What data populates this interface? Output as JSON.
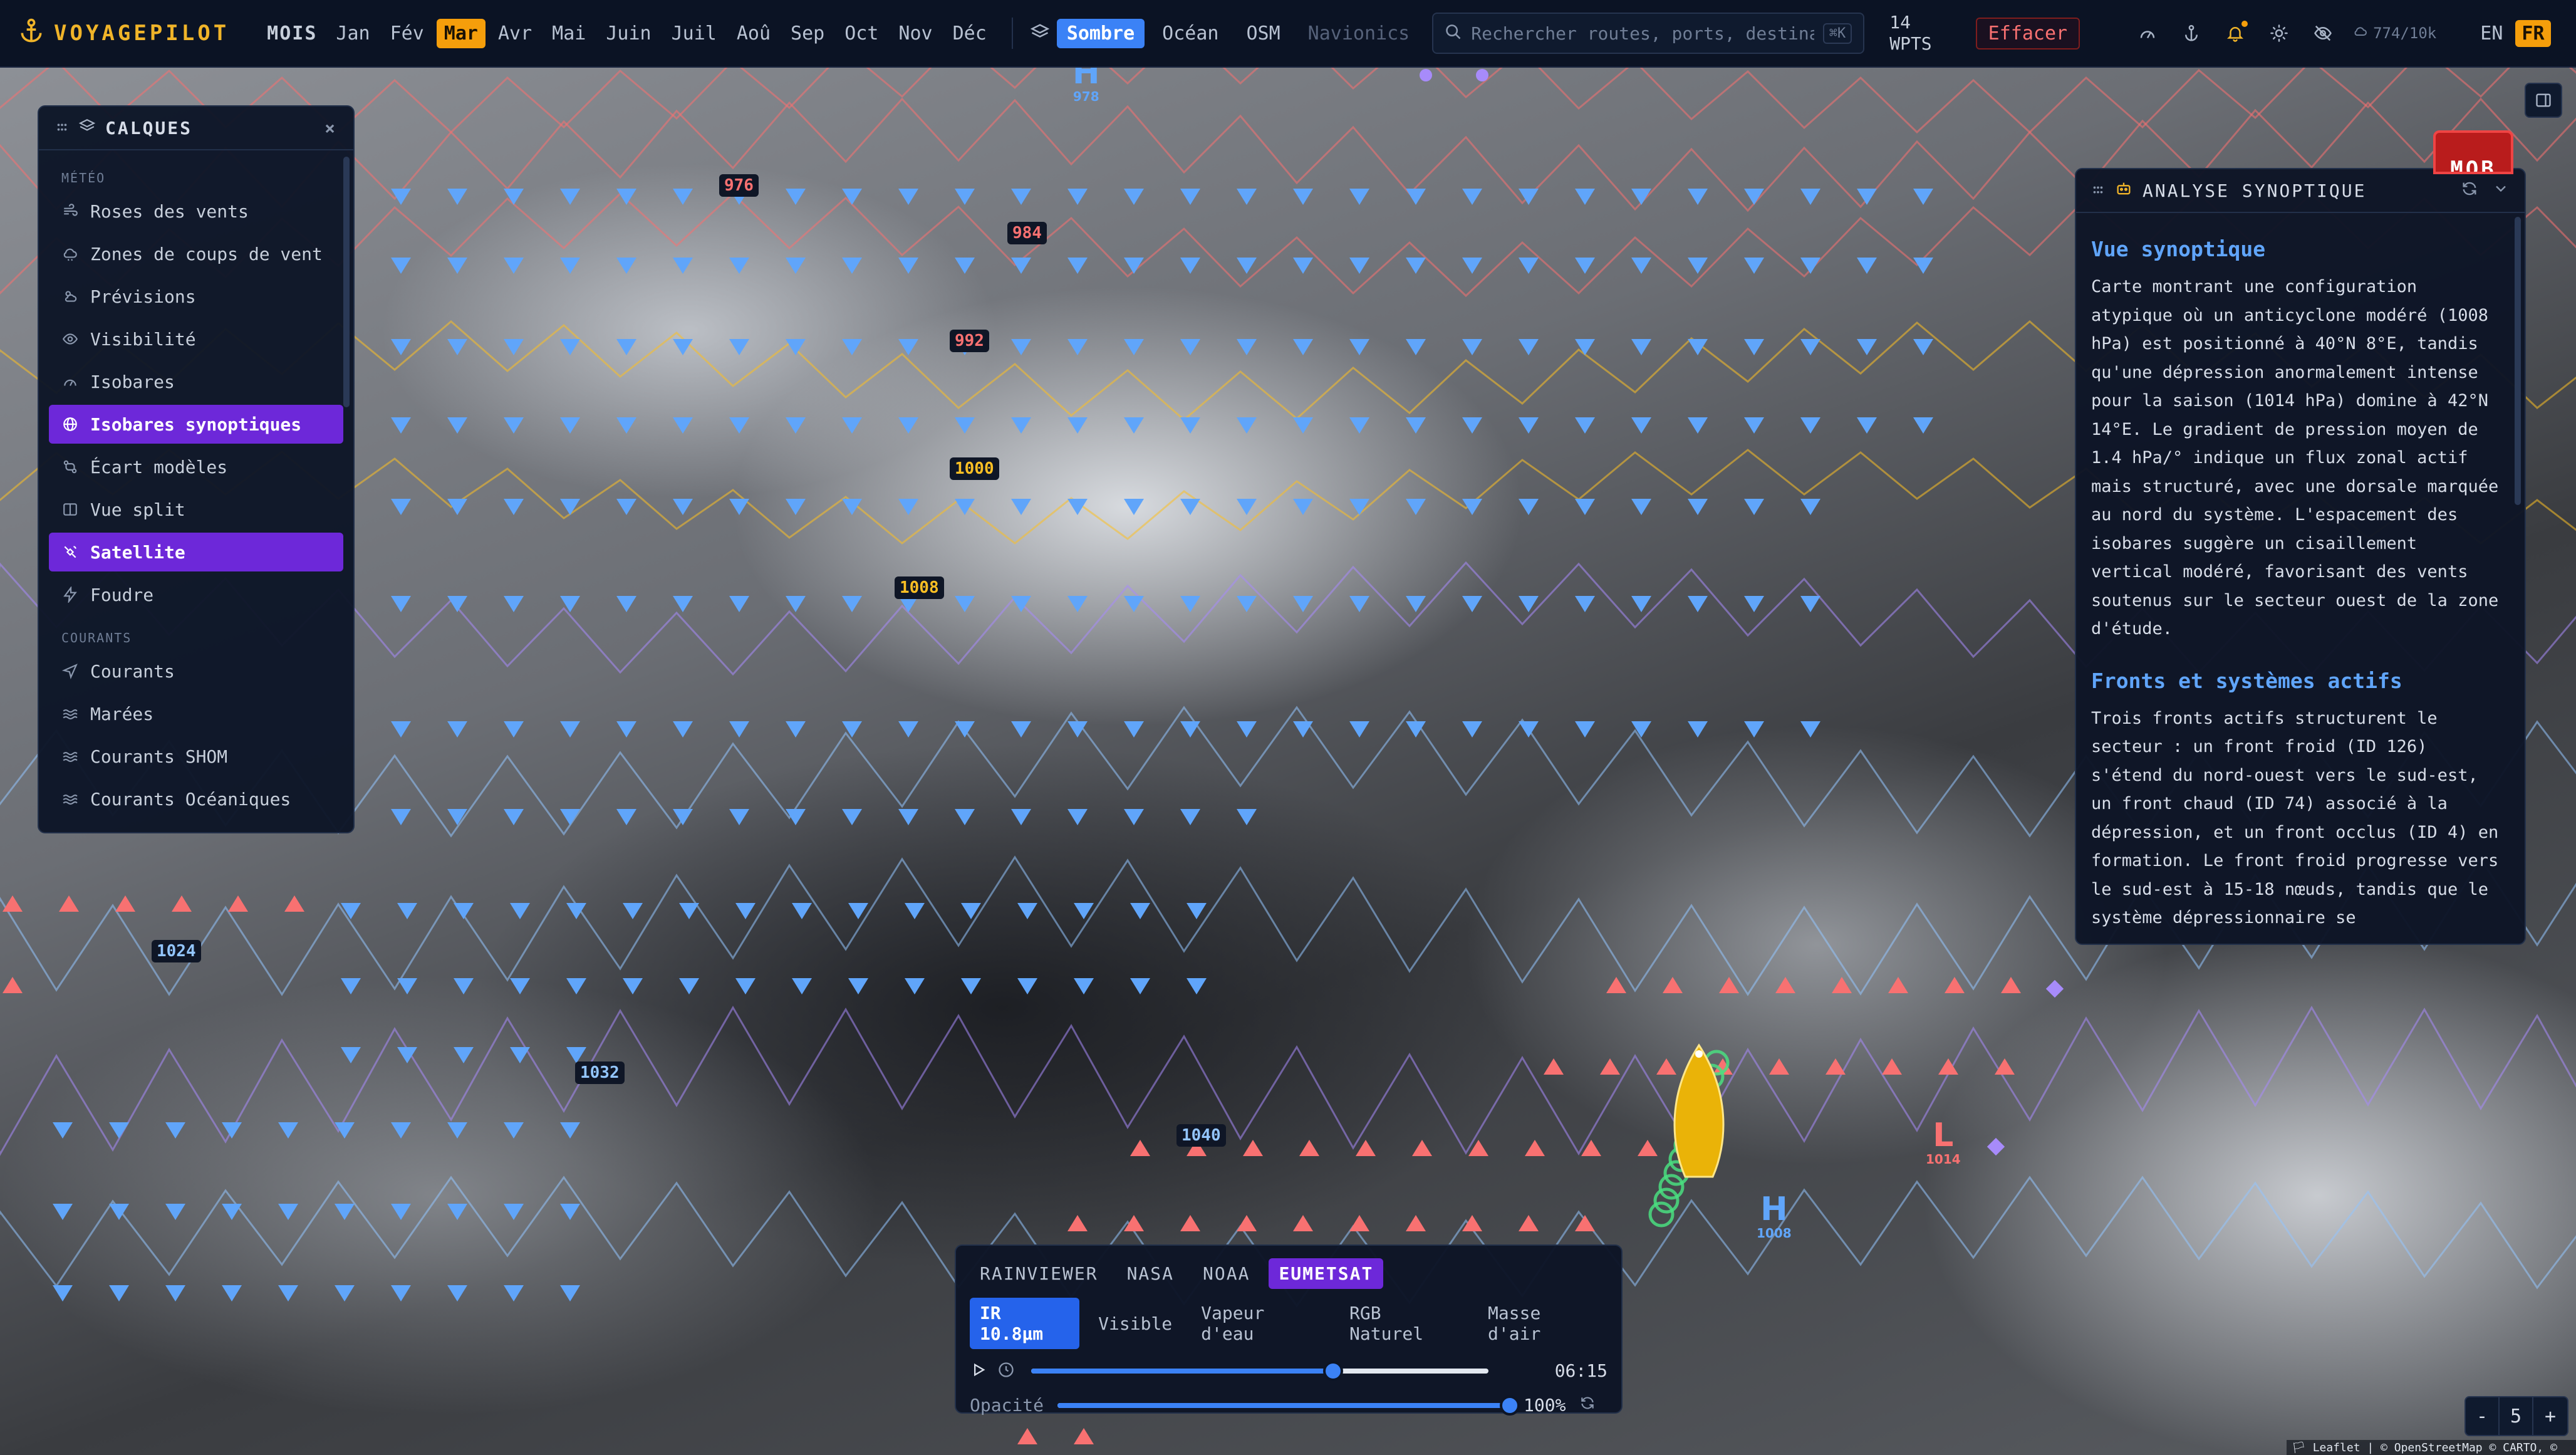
{
  "brand": {
    "name": "VOYAGEPILOT"
  },
  "months": {
    "label": "MOIS",
    "items": [
      "Jan",
      "Fév",
      "Mar",
      "Avr",
      "Mai",
      "Juin",
      "Juil",
      "Aoû",
      "Sep",
      "Oct",
      "Nov",
      "Déc"
    ],
    "active": "Mar"
  },
  "basemaps": {
    "items": [
      {
        "label": "Sombre",
        "state": "active"
      },
      {
        "label": "Océan",
        "state": "normal"
      },
      {
        "label": "OSM",
        "state": "normal"
      },
      {
        "label": "Navionics",
        "state": "disabled"
      }
    ]
  },
  "search": {
    "placeholder": "Rechercher routes, ports, destinations",
    "shortcut": "⌘K"
  },
  "waypoints": {
    "count": "14",
    "unit": "WPTS"
  },
  "clear_label": "Effacer",
  "usage": "774/10k",
  "languages": {
    "items": [
      "EN",
      "FR"
    ],
    "active": "FR"
  },
  "layers_panel": {
    "title": "CALQUES",
    "close": "×",
    "sections": [
      {
        "title": "MÉTÉO",
        "items": [
          {
            "label": "Roses des vents",
            "icon": "wind-icon",
            "active": false
          },
          {
            "label": "Zones de coups de vent",
            "icon": "cloud-icon",
            "active": false
          },
          {
            "label": "Prévisions",
            "icon": "sun-cloud-icon",
            "active": false
          },
          {
            "label": "Visibilité",
            "icon": "eye-icon",
            "active": false
          },
          {
            "label": "Isobares",
            "icon": "gauge-icon",
            "active": false
          },
          {
            "label": "Isobares synoptiques",
            "icon": "globe-icon",
            "active": true
          },
          {
            "label": "Écart modèles",
            "icon": "diff-icon",
            "active": false
          },
          {
            "label": "Vue split",
            "icon": "columns-icon",
            "active": false
          },
          {
            "label": "Satellite",
            "icon": "satellite-icon",
            "active": true
          },
          {
            "label": "Foudre",
            "icon": "lightning-icon",
            "active": false
          }
        ]
      },
      {
        "title": "COURANTS",
        "items": [
          {
            "label": "Courants",
            "icon": "navigation-icon",
            "active": false
          },
          {
            "label": "Marées",
            "icon": "waves-icon",
            "active": false
          },
          {
            "label": "Courants SHOM",
            "icon": "waves-icon",
            "active": false
          },
          {
            "label": "Courants Océaniques",
            "icon": "waves-icon",
            "active": false
          }
        ]
      }
    ]
  },
  "synoptic": {
    "title": "ANALYSE SYNOPTIQUE",
    "section1_title": "Vue synoptique",
    "section1_text": "Carte montrant une configuration atypique où un anticyclone modéré (1008 hPa) est positionné à 40°N 8°E, tandis qu'une dépression anormalement intense pour la saison (1014 hPa) domine à 42°N 14°E. Le gradient de pression moyen de 1.4 hPa/° indique un flux zonal actif mais structuré, avec une dorsale marquée au nord du système. L'espacement des isobares suggère un cisaillement vertical modéré, favorisant des vents soutenus sur le secteur ouest de la zone d'étude.",
    "section2_title": "Fronts et systèmes actifs",
    "section2_text": "Trois fronts actifs structurent le secteur : un front froid (ID 126) s'étend du nord-ouest vers le sud-est, un front chaud (ID 74) associé à la dépression, et un front occlus (ID 4) en formation. Le front froid progresse vers le sud-est à 15-18 nœuds, tandis que le système dépressionnaire se"
  },
  "satellite": {
    "sources": [
      {
        "label": "RAINVIEWER",
        "active": false
      },
      {
        "label": "NASA",
        "active": false
      },
      {
        "label": "NOAA",
        "active": false
      },
      {
        "label": "EUMETSAT",
        "active": true
      }
    ],
    "products": [
      {
        "label": "IR 10.8µm",
        "active": true
      },
      {
        "label": "Visible",
        "active": false
      },
      {
        "label": "Vapeur d'eau",
        "active": false
      },
      {
        "label": "RGB Naturel",
        "active": false
      },
      {
        "label": "Masse d'air",
        "active": false
      }
    ],
    "time": "06:15",
    "time_progress": 0.66,
    "opacity_label": "Opacité",
    "opacity_value": "100%",
    "opacity": 1.0
  },
  "isobars": [
    {
      "label": "976",
      "color": "#f87171"
    },
    {
      "label": "984",
      "color": "#f87171"
    },
    {
      "label": "992",
      "color": "#f87171"
    },
    {
      "label": "1000",
      "color": "#fbbf24"
    },
    {
      "label": "1008",
      "color": "#fbbf24"
    },
    {
      "label": "1024",
      "color": "#93c5fd"
    },
    {
      "label": "1032",
      "color": "#93c5fd"
    },
    {
      "label": "1040",
      "color": "#93c5fd"
    }
  ],
  "pressure_centers": [
    {
      "letter": "H",
      "value": "978",
      "color": "#60a5fa"
    },
    {
      "letter": "H",
      "value": "1008",
      "color": "#60a5fa"
    },
    {
      "letter": "L",
      "value": "1014",
      "color": "#f87171"
    }
  ],
  "mob_label": "MOB",
  "zoom": {
    "minus": "-",
    "level": "5",
    "plus": "+"
  },
  "attribution": "🏳 Leaflet | © OpenStreetMap © CARTO, © EUMETSAT",
  "colors": {
    "accent": "#3b82f6",
    "orange": "#f59e0b",
    "purple": "#6d28d9",
    "cold_front": "#60a5fa",
    "warm_front": "#f87171"
  }
}
